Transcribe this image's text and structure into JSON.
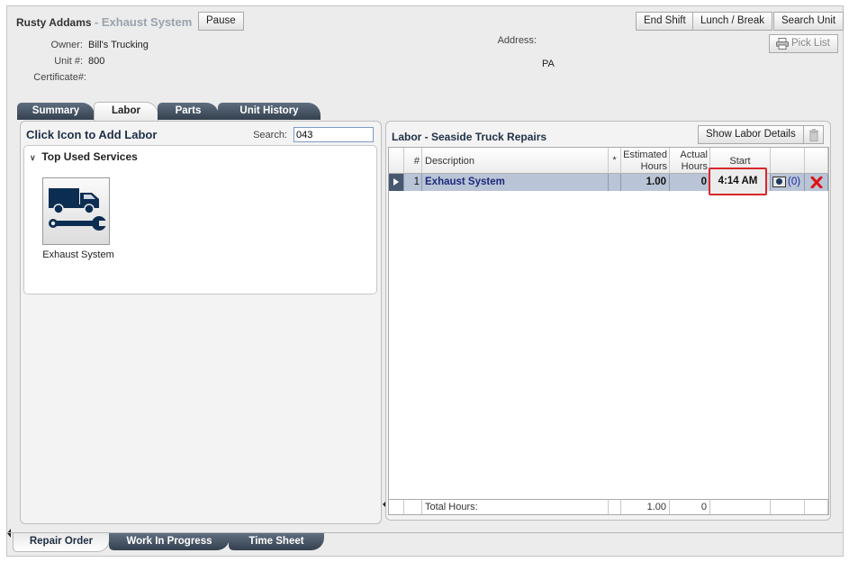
{
  "header": {
    "customer": "Rusty Addams",
    "job": "- Exhaust System",
    "pause_label": "Pause",
    "end_shift_label": "End Shift",
    "lunch_break_label": "Lunch / Break",
    "search_unit_label": "Search Unit",
    "pick_list_label": "Pick List",
    "owner_label": "Owner:",
    "owner_value": "Bill's Trucking",
    "unit_label": "Unit #:",
    "unit_value": "800",
    "certificate_label": "Certificate#:",
    "address_label": "Address:",
    "address_value": "PA"
  },
  "tabs": [
    {
      "label": "Summary",
      "active": false
    },
    {
      "label": "Labor",
      "active": true
    },
    {
      "label": "Parts",
      "active": false
    },
    {
      "label": "Unit History",
      "active": false
    }
  ],
  "left_panel": {
    "title": "Click Icon to Add Labor",
    "search_label": "Search:",
    "search_value": "043",
    "section_title": "Top Used Services",
    "services": [
      {
        "label": "Exhaust System",
        "icon": "truck-wrench-icon"
      }
    ]
  },
  "right_panel": {
    "title": "Labor - Seaside Truck Repairs",
    "show_details_label": "Show Labor Details",
    "columns": {
      "num": "#",
      "description": "Description",
      "flag": "*",
      "est_line1": "Estimated",
      "est_line2": "Hours",
      "act_line1": "Actual",
      "act_line2": "Hours",
      "start": "Start"
    },
    "rows": [
      {
        "num": "1",
        "description": "Exhaust System",
        "estimated": "1.00",
        "actual": "0",
        "start": "4:14 AM",
        "notes": "(0)"
      }
    ],
    "footer": {
      "label": "Total Hours:",
      "estimated": "1.00",
      "actual": "0"
    }
  },
  "bottom_tabs": [
    {
      "label": "Repair Order",
      "active": true
    },
    {
      "label": "Work In Progress",
      "active": false
    },
    {
      "label": "Time Sheet",
      "active": false
    }
  ],
  "colors": {
    "selected_row": "#b9c4d6",
    "highlight_box": "#d9262a",
    "tab_dark": "#34404e",
    "link_blue": "#1b2a7a"
  }
}
